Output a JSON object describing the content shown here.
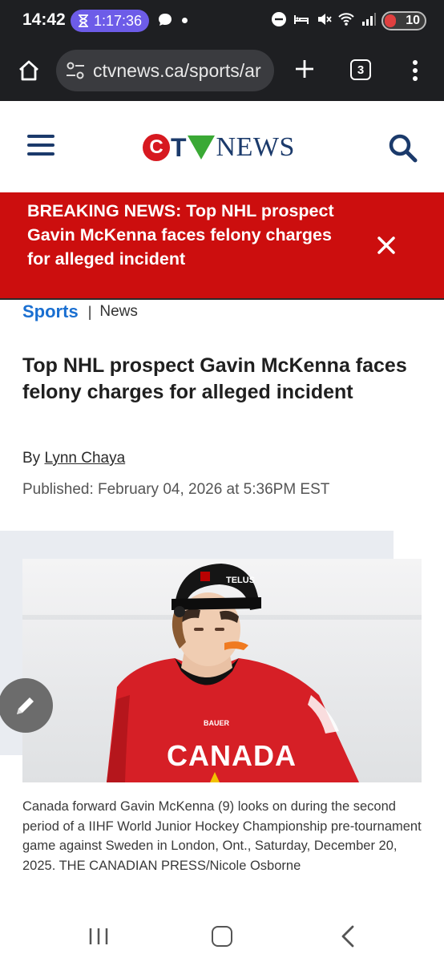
{
  "status_bar": {
    "time": "14:42",
    "timer": "1:17:36",
    "battery": "10"
  },
  "browser": {
    "url": "ctvnews.ca/sports/ar",
    "tab_count": "3"
  },
  "site": {
    "logo_letters": [
      "C",
      "T",
      "V"
    ],
    "logo_word": "NEWS",
    "brand_colors": {
      "red": "#d71920",
      "navy": "#1b3a6b",
      "green": "#3aa935"
    }
  },
  "breaking": {
    "text": "BREAKING NEWS: Top NHL prospect Gavin McKenna faces felony charges for alleged incident",
    "close_icon": "close-icon"
  },
  "breadcrumb": {
    "section": "Sports",
    "separator": "|",
    "subsection": "News"
  },
  "article": {
    "headline": "Top NHL prospect Gavin McKenna faces felony charges for alleged incident",
    "byline_prefix": "By",
    "author": "Lynn Chaya",
    "published": "Published: February 04, 2026 at 5:36PM EST",
    "photo": {
      "helmet_text": "TELUS",
      "brand_text": "BAUER",
      "jersey_text": "CANADA"
    },
    "caption": "Canada forward Gavin McKenna (9) looks on during the second period of a IIHF World Junior Hockey Championship pre-tournament game against Sweden in London, Ont., Saturday, December 20, 2025. THE CANADIAN PRESS/Nicole Osborne"
  }
}
